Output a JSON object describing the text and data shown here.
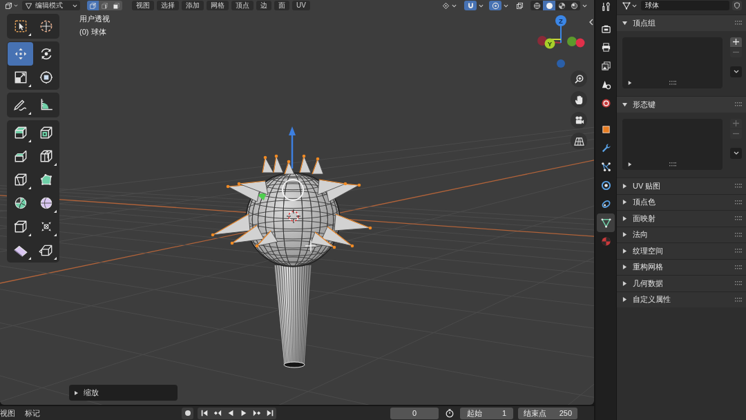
{
  "viewport_header": {
    "mode": "编辑模式",
    "select_modes": [
      {
        "selected": true
      },
      {
        "selected": false
      },
      {
        "selected": false
      }
    ],
    "menus": [
      "视图",
      "选择",
      "添加",
      "网格",
      "顶点",
      "边",
      "面",
      "UV"
    ],
    "snapping_on": true,
    "proportional_editing_on": true,
    "shading_modes": [
      {
        "selected": false
      },
      {
        "selected": true
      },
      {
        "selected": false
      },
      {
        "selected": false
      }
    ]
  },
  "toolbar": {
    "groups": [
      {
        "tools": [
          {
            "selected": false,
            "flyout": true
          },
          {
            "selected": false,
            "flyout": false
          }
        ]
      },
      {
        "tools": [
          {
            "selected": true,
            "flyout": false
          },
          {
            "selected": false,
            "flyout": false
          },
          {
            "selected": false,
            "flyout": true
          },
          {
            "selected": false,
            "flyout": false
          }
        ]
      },
      {
        "tools": [
          {
            "selected": false,
            "flyout": true
          },
          {
            "selected": false,
            "flyout": false
          }
        ]
      },
      {
        "tools": [
          {
            "selected": false,
            "flyout": true
          },
          {
            "selected": false,
            "flyout": false
          },
          {
            "selected": false,
            "flyout": false
          },
          {
            "selected": false,
            "flyout": true
          },
          {
            "selected": false,
            "flyout": true
          },
          {
            "selected": false,
            "flyout": false
          },
          {
            "selected": false,
            "flyout": false
          },
          {
            "selected": false,
            "flyout": true
          },
          {
            "selected": false,
            "flyout": true
          },
          {
            "selected": false,
            "flyout": true
          },
          {
            "selected": false,
            "flyout": true
          },
          {
            "selected": false,
            "flyout": true
          }
        ]
      }
    ]
  },
  "viewport": {
    "view_name": "用户透视",
    "object_info": "(0) 球体",
    "gizmo": {
      "z_label": "Z",
      "y_label": "Y"
    },
    "operator_panel": {
      "title": "缩放",
      "expanded": false
    }
  },
  "properties": {
    "data_name": "球体",
    "tab_groups": [
      {
        "tabs": [
          {
            "selected": false
          }
        ]
      },
      {
        "tabs": [
          {
            "selected": false
          },
          {
            "selected": false
          },
          {
            "selected": false
          },
          {
            "selected": false
          },
          {
            "selected": false
          }
        ]
      },
      {
        "tabs": [
          {
            "selected": false
          },
          {
            "selected": false
          },
          {
            "selected": false
          },
          {
            "selected": false
          },
          {
            "selected": false
          },
          {
            "selected": true
          },
          {
            "selected": false
          }
        ]
      }
    ],
    "panels": [
      {
        "title": "顶点组",
        "expanded": true,
        "add_disabled": false,
        "remove_disabled": true
      },
      {
        "title": "形态键",
        "expanded": true,
        "add_disabled": true,
        "remove_disabled": true
      },
      {
        "title": "UV 贴图",
        "expanded": false
      },
      {
        "title": "顶点色",
        "expanded": false
      },
      {
        "title": "面映射",
        "expanded": false
      },
      {
        "title": "法向",
        "expanded": false
      },
      {
        "title": "纹理空间",
        "expanded": false
      },
      {
        "title": "重构网格",
        "expanded": false
      },
      {
        "title": "几何数据",
        "expanded": false
      },
      {
        "title": "自定义属性",
        "expanded": false
      }
    ]
  },
  "timeline": {
    "menus": [
      "视图",
      "标记"
    ],
    "current_frame": "0",
    "start_label": "起始",
    "start_frame": "1",
    "end_label": "结束点",
    "end_frame": "250"
  }
}
